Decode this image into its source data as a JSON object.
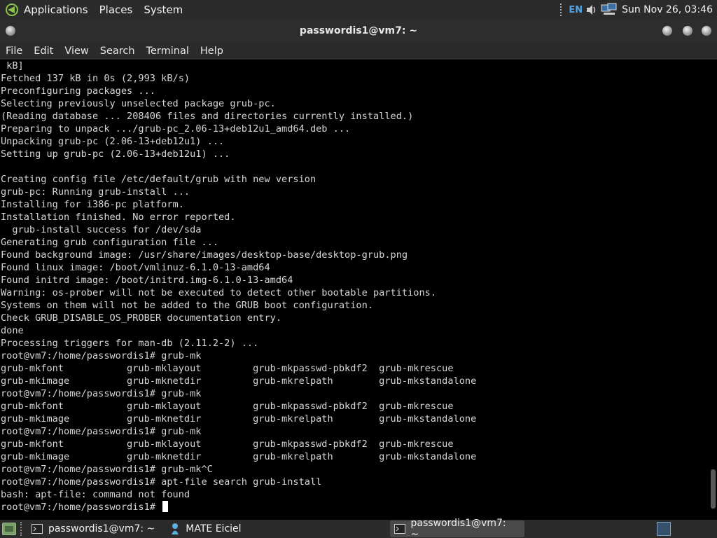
{
  "top_panel": {
    "menus": [
      "Applications",
      "Places",
      "System"
    ],
    "tray": {
      "language": "EN",
      "volume_icon": "speaker-icon",
      "network_icon": "network-icon",
      "clock": "Sun Nov 26, 03:46"
    }
  },
  "window": {
    "title": "passwordis1@vm7: ~"
  },
  "menubar": [
    "File",
    "Edit",
    "View",
    "Search",
    "Terminal",
    "Help"
  ],
  "terminal": {
    "lines": [
      " kB]",
      "Fetched 137 kB in 0s (2,993 kB/s)",
      "Preconfiguring packages ...",
      "Selecting previously unselected package grub-pc.",
      "(Reading database ... 208406 files and directories currently installed.)",
      "Preparing to unpack .../grub-pc_2.06-13+deb12u1_amd64.deb ...",
      "Unpacking grub-pc (2.06-13+deb12u1) ...",
      "Setting up grub-pc (2.06-13+deb12u1) ...",
      "",
      "Creating config file /etc/default/grub with new version",
      "grub-pc: Running grub-install ...",
      "Installing for i386-pc platform.",
      "Installation finished. No error reported.",
      "  grub-install success for /dev/sda",
      "Generating grub configuration file ...",
      "Found background image: /usr/share/images/desktop-base/desktop-grub.png",
      "Found linux image: /boot/vmlinuz-6.1.0-13-amd64",
      "Found initrd image: /boot/initrd.img-6.1.0-13-amd64",
      "Warning: os-prober will not be executed to detect other bootable partitions.",
      "Systems on them will not be added to the GRUB boot configuration.",
      "Check GRUB_DISABLE_OS_PROBER documentation entry.",
      "done",
      "Processing triggers for man-db (2.11.2-2) ...",
      "root@vm7:/home/passwordis1# grub-mk",
      "grub-mkfont           grub-mklayout         grub-mkpasswd-pbkdf2  grub-mkrescue",
      "grub-mkimage          grub-mknetdir         grub-mkrelpath        grub-mkstandalone",
      "root@vm7:/home/passwordis1# grub-mk",
      "grub-mkfont           grub-mklayout         grub-mkpasswd-pbkdf2  grub-mkrescue",
      "grub-mkimage          grub-mknetdir         grub-mkrelpath        grub-mkstandalone",
      "root@vm7:/home/passwordis1# grub-mk",
      "grub-mkfont           grub-mklayout         grub-mkpasswd-pbkdf2  grub-mkrescue",
      "grub-mkimage          grub-mknetdir         grub-mkrelpath        grub-mkstandalone",
      "root@vm7:/home/passwordis1# grub-mk^C",
      "root@vm7:/home/passwordis1# apt-file search grub-install",
      "bash: apt-file: command not found"
    ],
    "prompt": "root@vm7:/home/passwordis1# "
  },
  "taskbar": {
    "tasks": [
      {
        "label": "passwordis1@vm7: ~",
        "icon": "terminal-icon",
        "active": false
      },
      {
        "label": "MATE Eiciel",
        "icon": "eiciel-icon",
        "active": false
      },
      {
        "label": "passwordis1@vm7: ~",
        "icon": "terminal-icon",
        "active": true
      }
    ]
  },
  "colors": {
    "panel_bg": "#2b2b2b",
    "terminal_bg": "#000000",
    "terminal_fg": "#d6d6d6",
    "lang_accent": "#4ea6e8"
  }
}
